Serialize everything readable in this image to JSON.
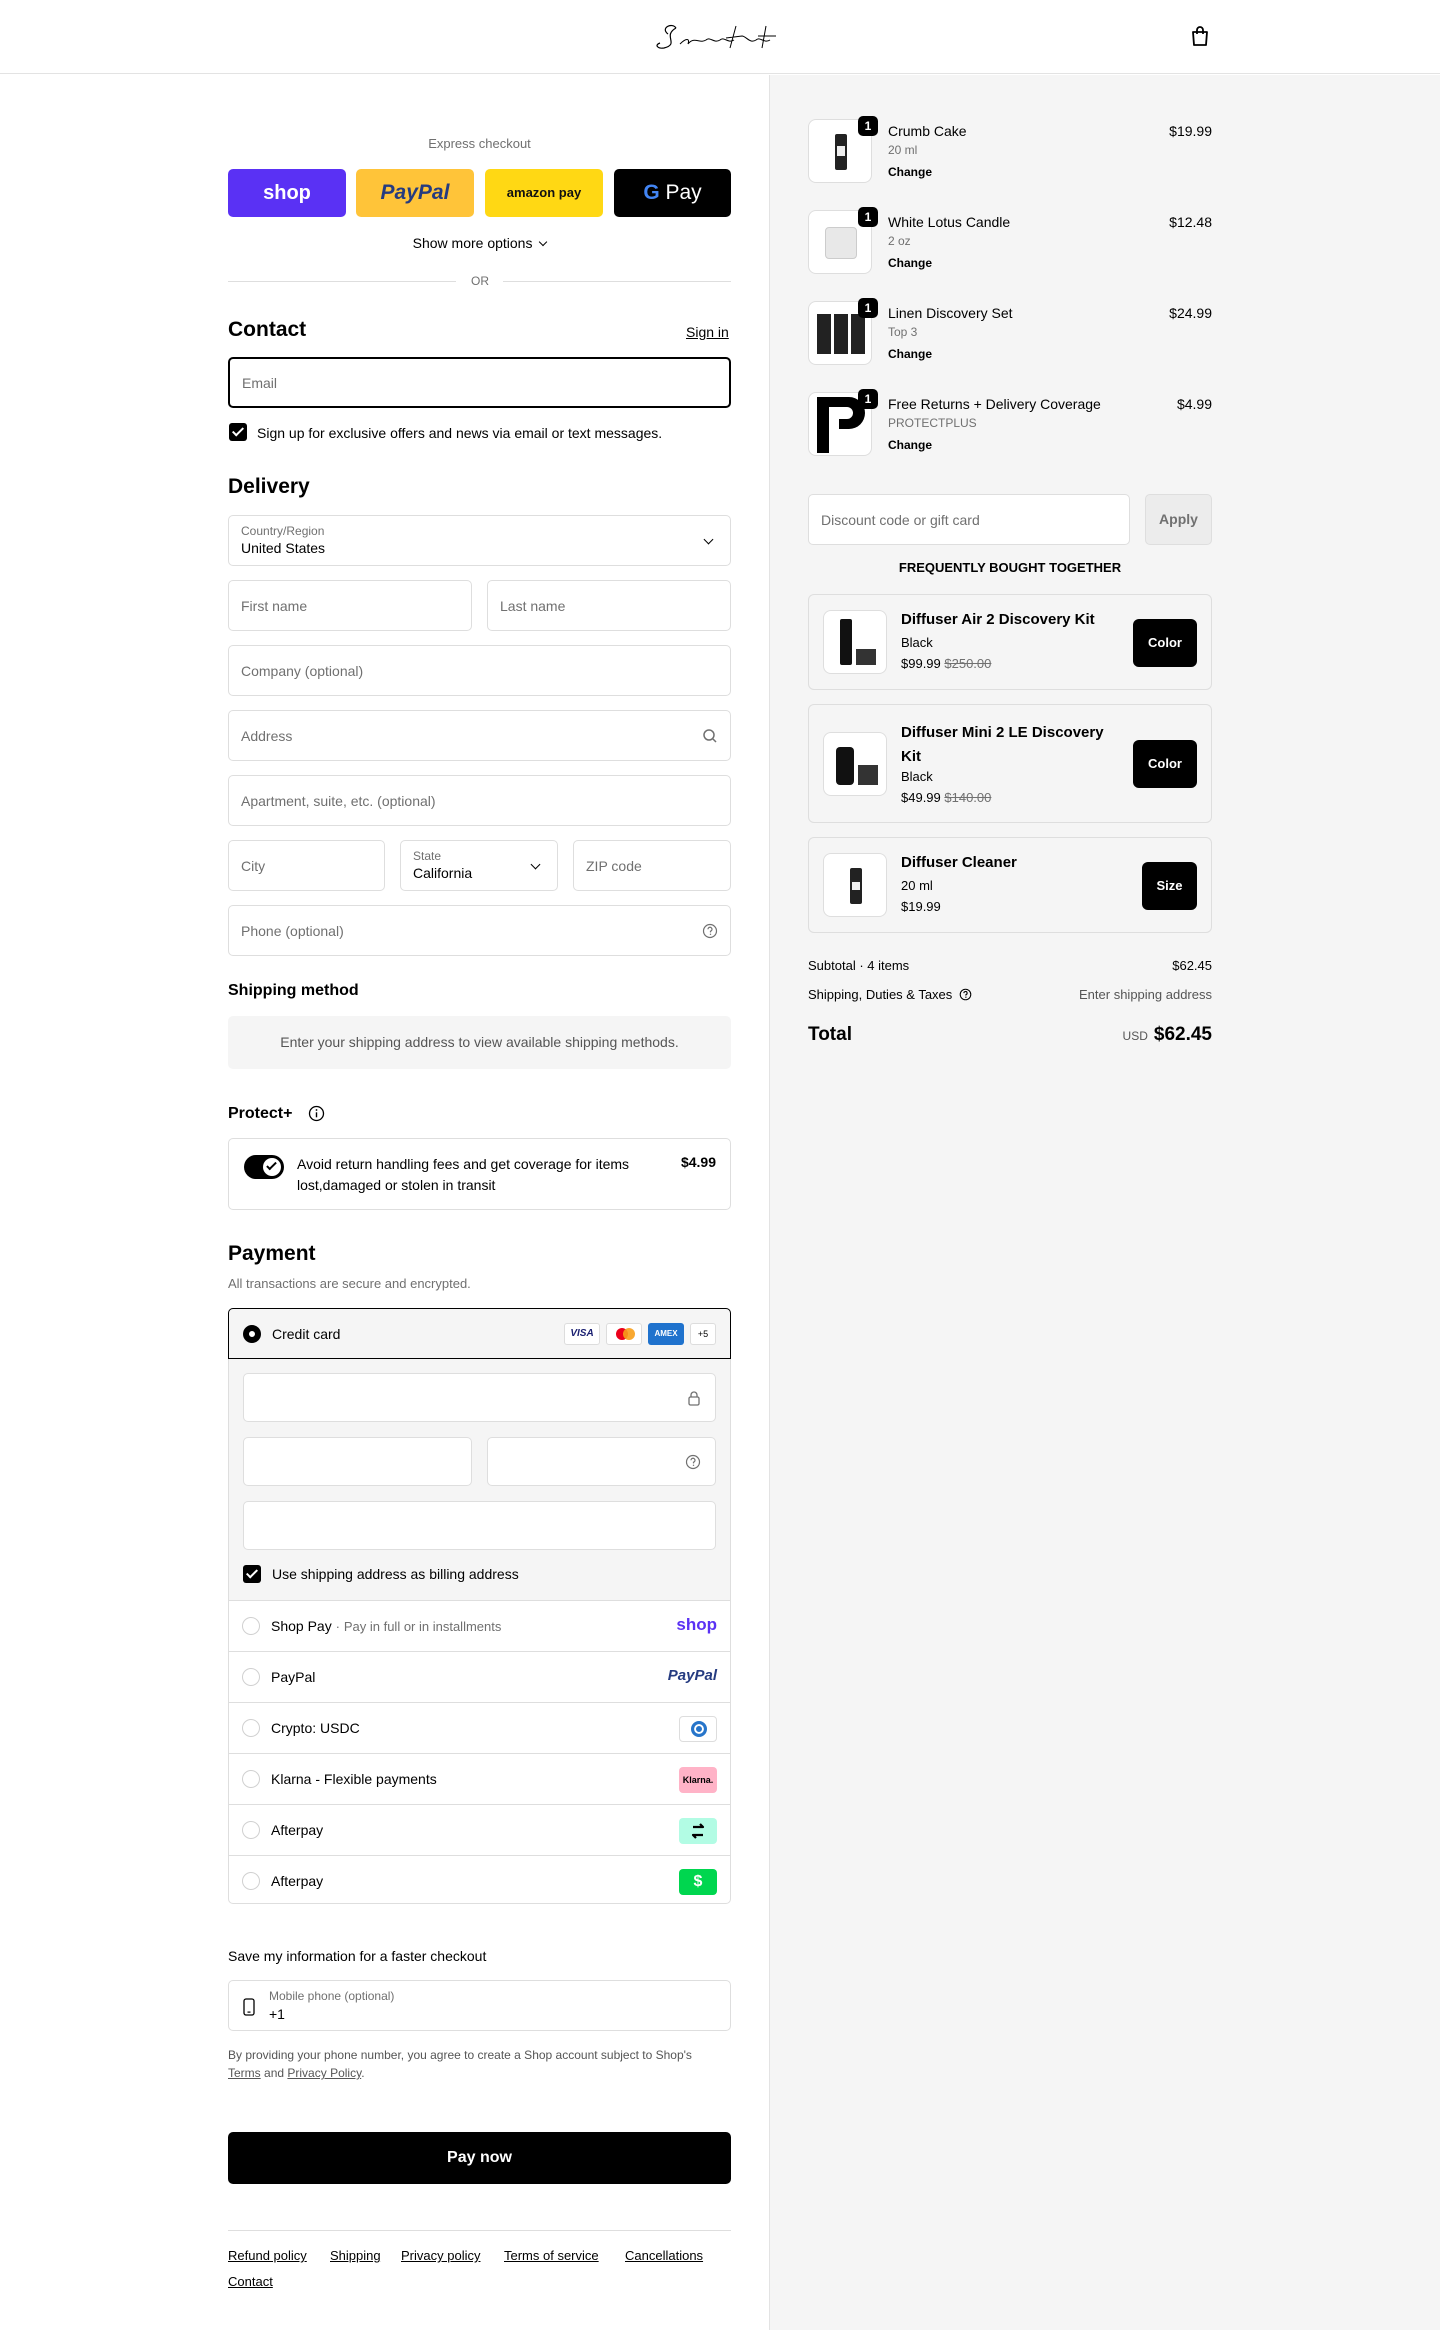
{
  "header": {
    "logo_text": "Scentiment",
    "cart_icon": "shopping-bag-icon"
  },
  "express": {
    "title": "Express checkout",
    "shop_label": "shop",
    "paypal_label": "PayPal",
    "amazon_label": "amazon pay",
    "gpay_label": "Pay",
    "show_more": "Show more options",
    "or": "OR"
  },
  "contact": {
    "title": "Contact",
    "sign_in": "Sign in",
    "email_placeholder": "Email",
    "newsletter_label": "Sign up for exclusive offers and news via email or text messages."
  },
  "delivery": {
    "title": "Delivery",
    "country_label": "Country/Region",
    "country_value": "United States",
    "first_name_placeholder": "First name",
    "last_name_placeholder": "Last name",
    "company_placeholder": "Company (optional)",
    "address_placeholder": "Address",
    "apartment_placeholder": "Apartment, suite, etc. (optional)",
    "city_placeholder": "City",
    "state_label": "State",
    "state_value": "California",
    "zip_placeholder": "ZIP code",
    "phone_placeholder": "Phone (optional)"
  },
  "shipping_method": {
    "title": "Shipping method",
    "notice": "Enter your shipping address to view available shipping methods."
  },
  "protect": {
    "title": "Protect+",
    "description": "Avoid return handling fees and get coverage for items lost,damaged or stolen in transit",
    "price": "$4.99",
    "enabled": true
  },
  "payment": {
    "title": "Payment",
    "subtitle": "All transactions are secure and encrypted.",
    "credit_card_label": "Credit card",
    "card_brands": [
      "VISA",
      "MC",
      "AMEX",
      "+5"
    ],
    "billing_label": "Use shipping address as billing address",
    "methods": [
      {
        "label": "Shop Pay",
        "sub": "Pay in full or in installments",
        "logo": "shop"
      },
      {
        "label": "PayPal",
        "sub": "",
        "logo": "PayPal"
      },
      {
        "label": "Crypto: USDC",
        "sub": "",
        "logo": "usdc"
      },
      {
        "label": "Klarna - Flexible payments",
        "sub": "",
        "logo": "Klarna."
      },
      {
        "label": "Afterpay",
        "sub": "",
        "logo": "afterpay"
      },
      {
        "label": "Afterpay",
        "sub": "",
        "logo": "$"
      }
    ]
  },
  "save_info": {
    "title": "Save my information for a faster checkout",
    "phone_label": "Mobile phone (optional)",
    "phone_value": "+1",
    "legal_prefix": "By providing your phone number, you agree to create a Shop account subject to Shop's",
    "terms": "Terms",
    "and": "and",
    "privacy": "Privacy Policy",
    "period": "."
  },
  "pay_button": "Pay now",
  "footer_links": [
    "Refund policy",
    "Shipping",
    "Privacy policy",
    "Terms of service",
    "Cancellations",
    "Contact"
  ],
  "cart": {
    "items": [
      {
        "name": "Crumb Cake",
        "variant": "20 ml",
        "change": "Change",
        "price": "$19.99",
        "qty": "1"
      },
      {
        "name": "White Lotus Candle",
        "variant": "2 oz",
        "change": "Change",
        "price": "$12.48",
        "qty": "1"
      },
      {
        "name": "Linen Discovery Set",
        "variant": "Top 3",
        "change": "Change",
        "price": "$24.99",
        "qty": "1"
      },
      {
        "name": "Free Returns + Delivery Coverage",
        "variant": "PROTECTPLUS",
        "change": "Change",
        "price": "$4.99",
        "qty": "1"
      }
    ],
    "discount_placeholder": "Discount code or gift card",
    "apply": "Apply",
    "fbt_title": "FREQUENTLY BOUGHT TOGETHER",
    "bundles": [
      {
        "name": "Diffuser Air 2 Discovery Kit",
        "variant": "Black",
        "price": "$99.99",
        "compare": "$250.00",
        "button": "Color"
      },
      {
        "name": "Diffuser Mini 2 LE Discovery Kit",
        "variant": "Black",
        "price": "$49.99",
        "compare": "$140.00",
        "button": "Color"
      },
      {
        "name": "Diffuser Cleaner",
        "variant": "20 ml",
        "price": "$19.99",
        "compare": "",
        "button": "Size"
      }
    ],
    "subtotal_label": "Subtotal · 4 items",
    "subtotal_value": "$62.45",
    "shipping_label": "Shipping, Duties & Taxes",
    "shipping_value": "Enter shipping address",
    "total_label": "Total",
    "currency": "USD",
    "total_value": "$62.45"
  }
}
